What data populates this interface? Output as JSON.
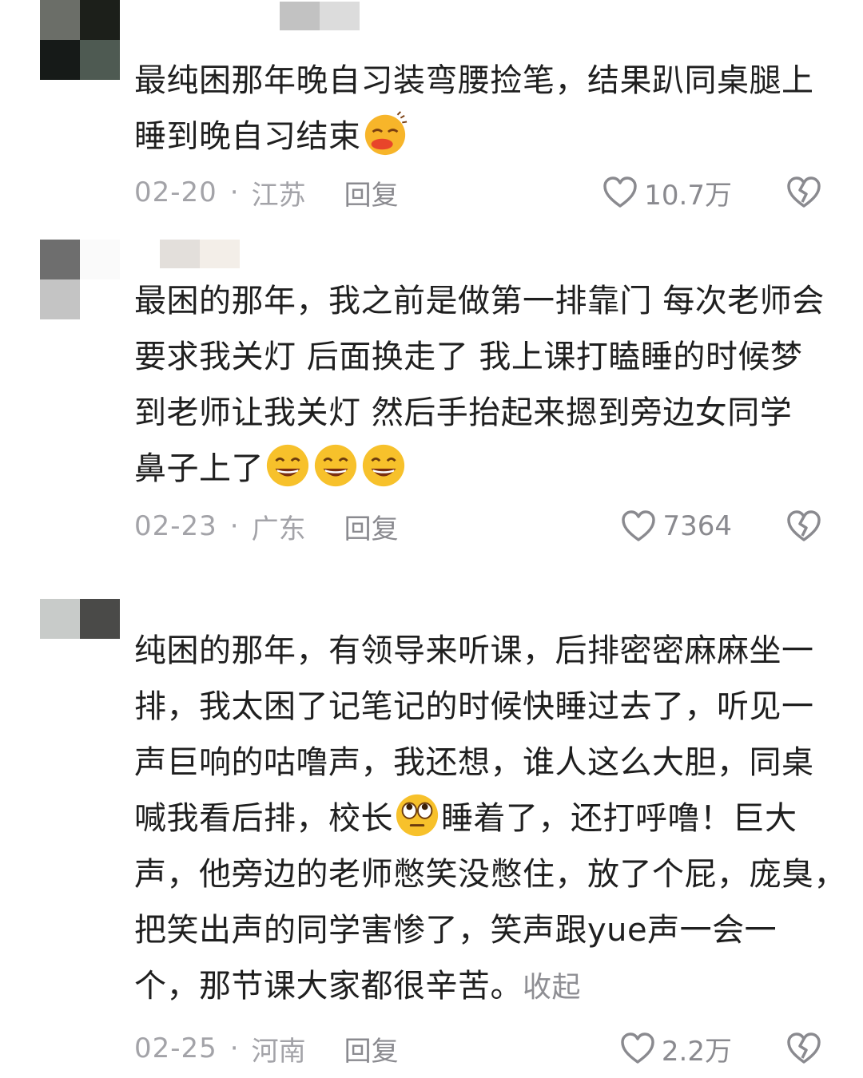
{
  "comments": [
    {
      "lines": [
        "最纯困那年晚自习装弯腰捡笔，结果趴同桌腿上",
        "睡到晚自习结束"
      ],
      "emoji": [
        "sleepy-face-emoji"
      ],
      "date": "02-20",
      "region": "江苏",
      "reply": "回复",
      "likes": "10.7万"
    },
    {
      "lines": [
        "最困的那年，我之前是做第一排靠门 每次老师会",
        "要求我关灯 后面换走了 我上课打瞌睡的时候梦",
        "到老师让我关灯 然后手抬起来摁到旁边女同学",
        "鼻子上了"
      ],
      "emoji": [
        "grinning-face-emoji",
        "grinning-face-emoji",
        "grinning-face-emoji"
      ],
      "date": "02-23",
      "region": "广东",
      "reply": "回复",
      "likes": "7364"
    },
    {
      "lines": [
        "纯困的那年，有领导来听课，后排密密麻麻坐一",
        "排，我太困了记笔记的时候快睡过去了，听见一",
        "声巨响的咕噜声，我还想，谁人这么大胆，同桌",
        "喊我看后排，校长",
        "睡着了，还打呼噜！巨大",
        "声，他旁边的老师憋笑没憋住，放了个屁，庞臭，",
        "把笑出声的同学害惨了，笑声跟yue声一会一",
        "个，那节课大家都很辛苦。"
      ],
      "emoji": [
        "eye-roll-face-emoji"
      ],
      "collapse": "收起",
      "date": "02-25",
      "region": "河南",
      "reply": "回复",
      "likes": "2.2万"
    }
  ],
  "meta_separator": "·",
  "colors": {
    "muted": "#a3a3a8",
    "text": "#1f1f1f",
    "emoji_yellow": "#f5b820"
  }
}
